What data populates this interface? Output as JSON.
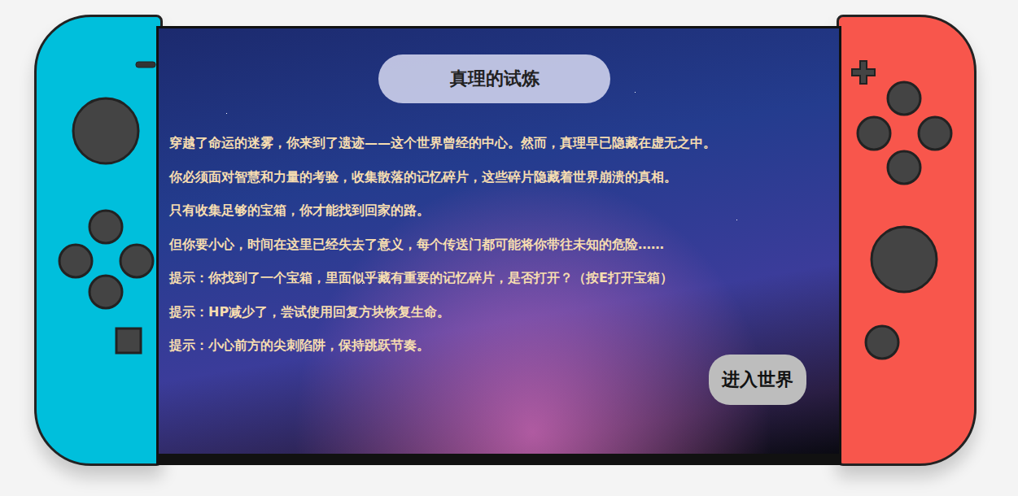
{
  "window": {
    "title": "真理的试炼"
  },
  "story": [
    "穿越了命运的迷雾，你来到了遗迹——这个世界曾经的中心。然而，真理早已隐藏在虚无之中。",
    "你必须面对智慧和力量的考验，收集散落的记忆碎片，这些碎片隐藏着世界崩溃的真相。",
    "只有收集足够的宝箱，你才能找到回家的路。",
    "但你要小心，时间在这里已经失去了意义，每个传送门都可能将你带往未知的危险……"
  ],
  "hints": [
    "提示：你找到了一个宝箱，里面似乎藏有重要的记忆碎片，是否打开？（按E打开宝箱）",
    "提示：HP减少了，尝试使用回复方块恢复生命。",
    "提示：小心前方的尖刺陷阱，保持跳跃节奏。"
  ],
  "buttons": [
    "进入世界"
  ]
}
